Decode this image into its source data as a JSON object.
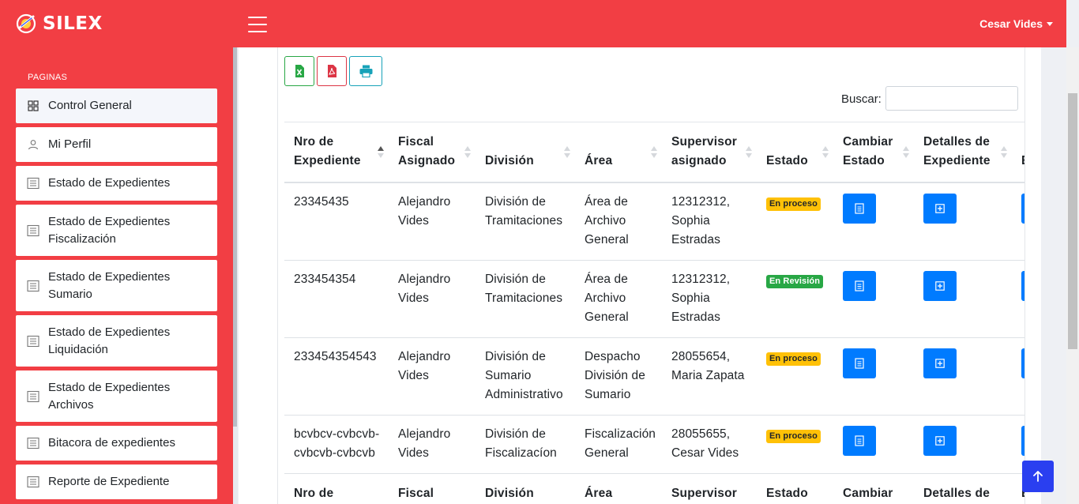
{
  "header": {
    "brand": "SILEX",
    "user_name": "Cesar Vides"
  },
  "sidebar": {
    "section_label": "PAGINAS",
    "items": [
      {
        "label": "Control General",
        "icon": "grid-icon"
      },
      {
        "label": "Mi Perfil",
        "icon": "user-icon"
      },
      {
        "label": "Estado de Expedientes",
        "icon": "document-list-icon"
      },
      {
        "label": "Estado de Expedientes Fiscalización",
        "icon": "document-list-icon"
      },
      {
        "label": "Estado de Expedientes Sumario",
        "icon": "document-list-icon"
      },
      {
        "label": "Estado de Expedientes Liquidación",
        "icon": "document-list-icon"
      },
      {
        "label": "Estado de Expedientes Archivos",
        "icon": "document-list-icon"
      },
      {
        "label": "Bitacora de expedientes",
        "icon": "document-list-icon"
      },
      {
        "label": "Reporte de Expediente",
        "icon": "document-list-icon"
      }
    ]
  },
  "toolbar": {
    "export_buttons": [
      "excel-icon",
      "pdf-icon",
      "print-icon"
    ],
    "search_label": "Buscar:",
    "search_value": ""
  },
  "table": {
    "columns": [
      "Nro de Expediente",
      "Fiscal Asignado",
      "División",
      "Área",
      "Supervisor asignado",
      "Estado",
      "Cambiar Estado",
      "Detalles de Expediente",
      "E E"
    ],
    "rows": [
      {
        "nro": "23345435",
        "fiscal": "Alejandro Vides",
        "division": "División de Tramitaciones",
        "area": "Área de Archivo General",
        "supervisor": "12312312, Sophia Estradas",
        "estado": "En proceso"
      },
      {
        "nro": "233454354",
        "fiscal": "Alejandro Vides",
        "division": "División de Tramitaciones",
        "area": "Área de Archivo General",
        "supervisor": "12312312, Sophia Estradas",
        "estado": "En Revisión"
      },
      {
        "nro": "233454354543",
        "fiscal": "Alejandro Vides",
        "division": "División de Sumario Administrativo",
        "area": "Despacho División de Sumario",
        "supervisor": "28055654, Maria Zapata",
        "estado": "En proceso"
      },
      {
        "nro": "bcvbcv-cvbcvb-cvbcvb-cvbcvb",
        "fiscal": "Alejandro Vides",
        "division": "División de Fiscalizacíon",
        "area": "Fiscalización General",
        "supervisor": "28055655, Cesar Vides",
        "estado": "En proceso"
      }
    ],
    "footer_columns": [
      "Nro de",
      "Fiscal",
      "División",
      "Área",
      "Supervisor",
      "Estado",
      "Cambiar",
      "Detalles de",
      "E"
    ]
  },
  "colors": {
    "brand": "#f23e44",
    "primary": "#007bff",
    "warning": "#ffc107",
    "success": "#28a745"
  }
}
